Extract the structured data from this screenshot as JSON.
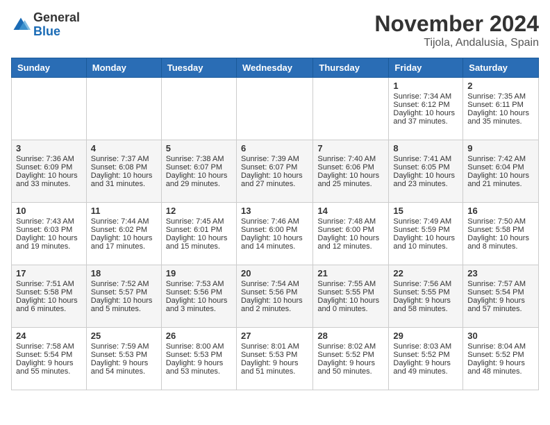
{
  "header": {
    "logo": {
      "general": "General",
      "blue": "Blue"
    },
    "title": "November 2024",
    "location": "Tijola, Andalusia, Spain"
  },
  "weekdays": [
    "Sunday",
    "Monday",
    "Tuesday",
    "Wednesday",
    "Thursday",
    "Friday",
    "Saturday"
  ],
  "weeks": [
    [
      {
        "day": "",
        "sunrise": "",
        "sunset": "",
        "daylight": ""
      },
      {
        "day": "",
        "sunrise": "",
        "sunset": "",
        "daylight": ""
      },
      {
        "day": "",
        "sunrise": "",
        "sunset": "",
        "daylight": ""
      },
      {
        "day": "",
        "sunrise": "",
        "sunset": "",
        "daylight": ""
      },
      {
        "day": "",
        "sunrise": "",
        "sunset": "",
        "daylight": ""
      },
      {
        "day": "1",
        "sunrise": "Sunrise: 7:34 AM",
        "sunset": "Sunset: 6:12 PM",
        "daylight": "Daylight: 10 hours and 37 minutes."
      },
      {
        "day": "2",
        "sunrise": "Sunrise: 7:35 AM",
        "sunset": "Sunset: 6:11 PM",
        "daylight": "Daylight: 10 hours and 35 minutes."
      }
    ],
    [
      {
        "day": "3",
        "sunrise": "Sunrise: 7:36 AM",
        "sunset": "Sunset: 6:09 PM",
        "daylight": "Daylight: 10 hours and 33 minutes."
      },
      {
        "day": "4",
        "sunrise": "Sunrise: 7:37 AM",
        "sunset": "Sunset: 6:08 PM",
        "daylight": "Daylight: 10 hours and 31 minutes."
      },
      {
        "day": "5",
        "sunrise": "Sunrise: 7:38 AM",
        "sunset": "Sunset: 6:07 PM",
        "daylight": "Daylight: 10 hours and 29 minutes."
      },
      {
        "day": "6",
        "sunrise": "Sunrise: 7:39 AM",
        "sunset": "Sunset: 6:07 PM",
        "daylight": "Daylight: 10 hours and 27 minutes."
      },
      {
        "day": "7",
        "sunrise": "Sunrise: 7:40 AM",
        "sunset": "Sunset: 6:06 PM",
        "daylight": "Daylight: 10 hours and 25 minutes."
      },
      {
        "day": "8",
        "sunrise": "Sunrise: 7:41 AM",
        "sunset": "Sunset: 6:05 PM",
        "daylight": "Daylight: 10 hours and 23 minutes."
      },
      {
        "day": "9",
        "sunrise": "Sunrise: 7:42 AM",
        "sunset": "Sunset: 6:04 PM",
        "daylight": "Daylight: 10 hours and 21 minutes."
      }
    ],
    [
      {
        "day": "10",
        "sunrise": "Sunrise: 7:43 AM",
        "sunset": "Sunset: 6:03 PM",
        "daylight": "Daylight: 10 hours and 19 minutes."
      },
      {
        "day": "11",
        "sunrise": "Sunrise: 7:44 AM",
        "sunset": "Sunset: 6:02 PM",
        "daylight": "Daylight: 10 hours and 17 minutes."
      },
      {
        "day": "12",
        "sunrise": "Sunrise: 7:45 AM",
        "sunset": "Sunset: 6:01 PM",
        "daylight": "Daylight: 10 hours and 15 minutes."
      },
      {
        "day": "13",
        "sunrise": "Sunrise: 7:46 AM",
        "sunset": "Sunset: 6:00 PM",
        "daylight": "Daylight: 10 hours and 14 minutes."
      },
      {
        "day": "14",
        "sunrise": "Sunrise: 7:48 AM",
        "sunset": "Sunset: 6:00 PM",
        "daylight": "Daylight: 10 hours and 12 minutes."
      },
      {
        "day": "15",
        "sunrise": "Sunrise: 7:49 AM",
        "sunset": "Sunset: 5:59 PM",
        "daylight": "Daylight: 10 hours and 10 minutes."
      },
      {
        "day": "16",
        "sunrise": "Sunrise: 7:50 AM",
        "sunset": "Sunset: 5:58 PM",
        "daylight": "Daylight: 10 hours and 8 minutes."
      }
    ],
    [
      {
        "day": "17",
        "sunrise": "Sunrise: 7:51 AM",
        "sunset": "Sunset: 5:58 PM",
        "daylight": "Daylight: 10 hours and 6 minutes."
      },
      {
        "day": "18",
        "sunrise": "Sunrise: 7:52 AM",
        "sunset": "Sunset: 5:57 PM",
        "daylight": "Daylight: 10 hours and 5 minutes."
      },
      {
        "day": "19",
        "sunrise": "Sunrise: 7:53 AM",
        "sunset": "Sunset: 5:56 PM",
        "daylight": "Daylight: 10 hours and 3 minutes."
      },
      {
        "day": "20",
        "sunrise": "Sunrise: 7:54 AM",
        "sunset": "Sunset: 5:56 PM",
        "daylight": "Daylight: 10 hours and 2 minutes."
      },
      {
        "day": "21",
        "sunrise": "Sunrise: 7:55 AM",
        "sunset": "Sunset: 5:55 PM",
        "daylight": "Daylight: 10 hours and 0 minutes."
      },
      {
        "day": "22",
        "sunrise": "Sunrise: 7:56 AM",
        "sunset": "Sunset: 5:55 PM",
        "daylight": "Daylight: 9 hours and 58 minutes."
      },
      {
        "day": "23",
        "sunrise": "Sunrise: 7:57 AM",
        "sunset": "Sunset: 5:54 PM",
        "daylight": "Daylight: 9 hours and 57 minutes."
      }
    ],
    [
      {
        "day": "24",
        "sunrise": "Sunrise: 7:58 AM",
        "sunset": "Sunset: 5:54 PM",
        "daylight": "Daylight: 9 hours and 55 minutes."
      },
      {
        "day": "25",
        "sunrise": "Sunrise: 7:59 AM",
        "sunset": "Sunset: 5:53 PM",
        "daylight": "Daylight: 9 hours and 54 minutes."
      },
      {
        "day": "26",
        "sunrise": "Sunrise: 8:00 AM",
        "sunset": "Sunset: 5:53 PM",
        "daylight": "Daylight: 9 hours and 53 minutes."
      },
      {
        "day": "27",
        "sunrise": "Sunrise: 8:01 AM",
        "sunset": "Sunset: 5:53 PM",
        "daylight": "Daylight: 9 hours and 51 minutes."
      },
      {
        "day": "28",
        "sunrise": "Sunrise: 8:02 AM",
        "sunset": "Sunset: 5:52 PM",
        "daylight": "Daylight: 9 hours and 50 minutes."
      },
      {
        "day": "29",
        "sunrise": "Sunrise: 8:03 AM",
        "sunset": "Sunset: 5:52 PM",
        "daylight": "Daylight: 9 hours and 49 minutes."
      },
      {
        "day": "30",
        "sunrise": "Sunrise: 8:04 AM",
        "sunset": "Sunset: 5:52 PM",
        "daylight": "Daylight: 9 hours and 48 minutes."
      }
    ]
  ]
}
